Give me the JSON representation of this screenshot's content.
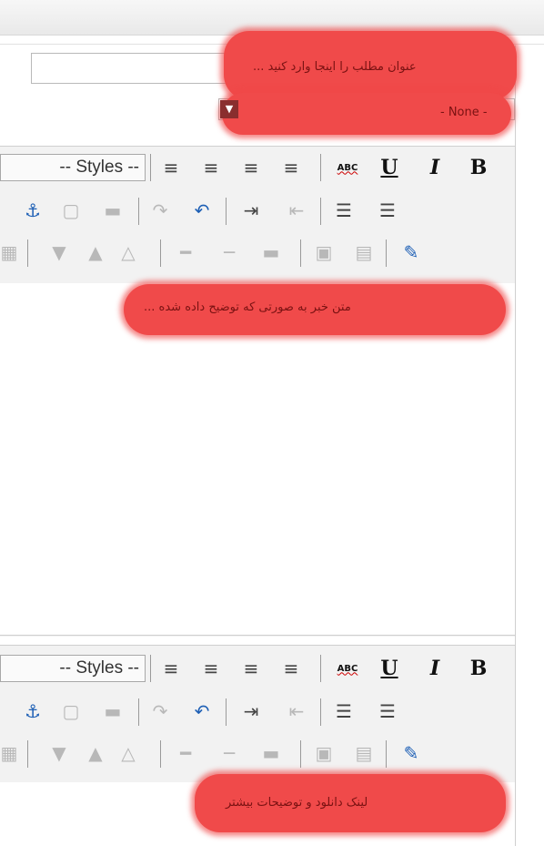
{
  "title_field": {
    "placeholder": "عنوان مطلب را اینجا وارد کنید ..."
  },
  "category_select": {
    "selected": "- None -"
  },
  "toolbar": {
    "styles_label": "-- Styles --",
    "spellcheck_label": "ABC",
    "underline_label": "U",
    "italic_label": "I",
    "bold_label": "B"
  },
  "main_editor": {
    "annotation": "متن خبر به صورتی که توضیح داده شده ..."
  },
  "second_editor": {
    "annotation": "لینک دانلود و توضیحات بیشتر"
  },
  "colors": {
    "highlight": "#f04a4a",
    "icon_blue": "#1d5fb5"
  }
}
